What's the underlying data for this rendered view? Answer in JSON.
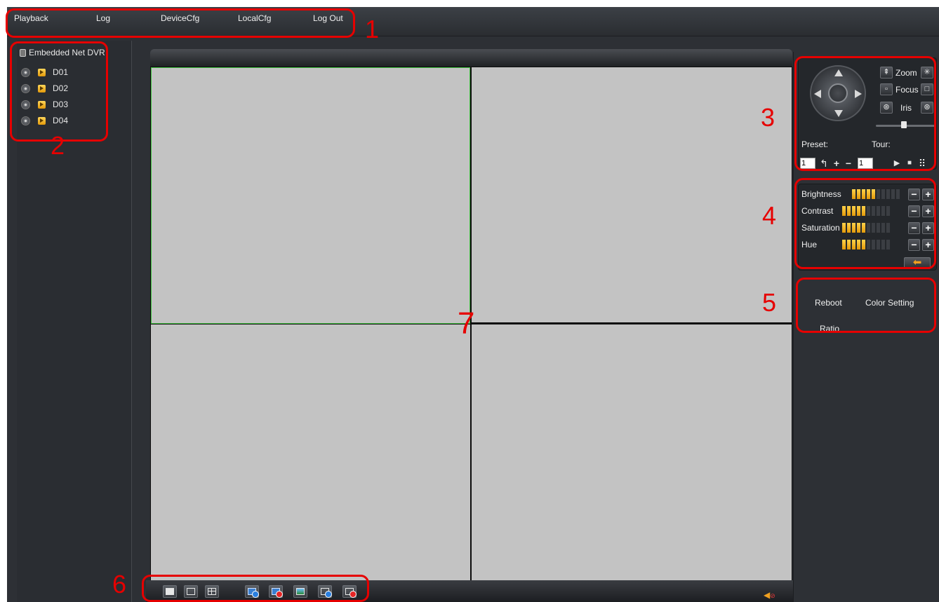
{
  "menu": {
    "items": [
      "Playback",
      "Log",
      "DeviceCfg",
      "LocalCfg",
      "Log Out"
    ]
  },
  "tree": {
    "root_label": "Embedded Net DVR",
    "channels": [
      "D01",
      "D02",
      "D03",
      "D04"
    ]
  },
  "ptz": {
    "zoom_label": "Zoom",
    "focus_label": "Focus",
    "iris_label": "Iris",
    "preset_label": "Preset:",
    "tour_label": "Tour:",
    "preset_value": "1",
    "tour_value": "1"
  },
  "color": {
    "rows": [
      {
        "label": "Brightness",
        "level": 5,
        "max": 10
      },
      {
        "label": "Contrast",
        "level": 5,
        "max": 10
      },
      {
        "label": "Saturation",
        "level": 5,
        "max": 10
      },
      {
        "label": "Hue",
        "level": 5,
        "max": 10
      }
    ],
    "accent": "#f0a020"
  },
  "options": {
    "reboot_label": "Reboot",
    "color_setting_label": "Color Setting",
    "ratio_label": "Ratio"
  },
  "video": {
    "layout": "2x2",
    "selected_cell": 1,
    "selected_color": "#3fbf3f"
  },
  "annotations": [
    "1",
    "2",
    "3",
    "4",
    "5",
    "6",
    "7"
  ],
  "annotation_color": "#e60000"
}
